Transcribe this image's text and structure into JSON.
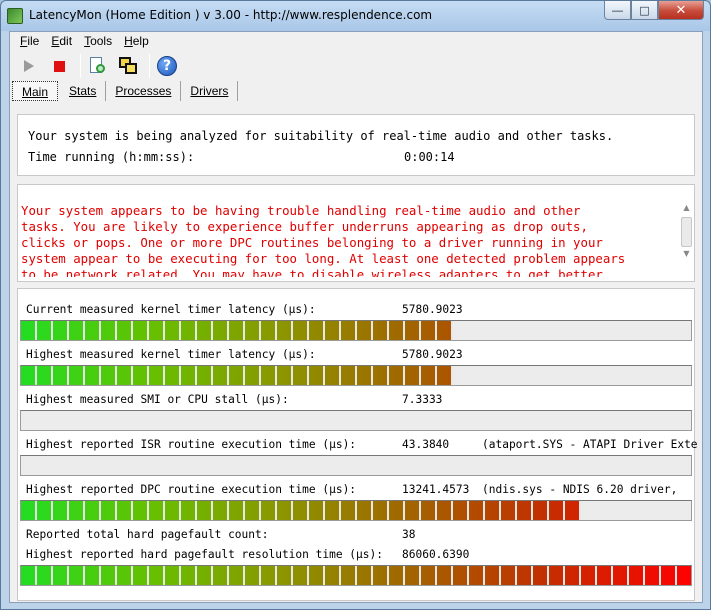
{
  "window": {
    "title": "LatencyMon  (Home Edition ) v 3.00 - http://www.resplendence.com"
  },
  "menu": [
    {
      "key": "F",
      "rest": "ile"
    },
    {
      "key": "E",
      "rest": "dit"
    },
    {
      "key": "T",
      "rest": "ools"
    },
    {
      "key": "H",
      "rest": "elp"
    }
  ],
  "toolbar": {
    "icons": [
      "play-icon",
      "stop-icon",
      "scan-icon",
      "windows-icon",
      "help-icon"
    ],
    "help_glyph": "?"
  },
  "tabs": [
    "Main",
    "Stats",
    "Processes",
    "Drivers"
  ],
  "status": {
    "line1": "Your system is being analyzed for suitability of real-time audio and other tasks.",
    "time_label": "Time running (h:mm:ss):",
    "time_value": "0:00:14"
  },
  "verdict": {
    "lines": [
      "Your system appears to be having trouble handling real-time audio and other",
      "tasks. You are likely to experience buffer underruns appearing as drop outs,",
      "clicks or pops. One or more DPC routines belonging to a driver running in your",
      "system appear to be executing for too long. At least one detected problem appears",
      "to be network related. You may have to disable wireless adapters to get better"
    ],
    "color": "#e00000"
  },
  "metrics": [
    {
      "label": "Current measured kernel timer latency (µs):",
      "value": "5780.9023",
      "extra": "",
      "bar": true,
      "level": 0.64
    },
    {
      "label": "Highest measured kernel timer latency (µs):",
      "value": "5780.9023",
      "extra": "",
      "bar": true,
      "level": 0.64
    },
    {
      "label": "Highest measured SMI or CPU stall (µs):",
      "value": "7.3333",
      "extra": "",
      "bar": true,
      "level": 0.0
    },
    {
      "label": "Highest reported ISR routine execution time (µs):",
      "value": "43.3840",
      "extra": "(ataport.SYS - ATAPI Driver Exter",
      "bar": true,
      "level": 0.0
    },
    {
      "label": "Highest reported DPC routine execution time (µs):",
      "value": "13241.4573",
      "extra": "(ndis.sys - NDIS 6.20 driver,",
      "bar": true,
      "level": 0.83
    },
    {
      "label": "Reported total hard pagefault count:",
      "value": "38",
      "extra": "",
      "bar": false,
      "level": null
    },
    {
      "label": "Highest reported hard pagefault resolution time (µs):",
      "value": "86060.6390",
      "extra": "",
      "bar": true,
      "level": 1.0
    }
  ]
}
